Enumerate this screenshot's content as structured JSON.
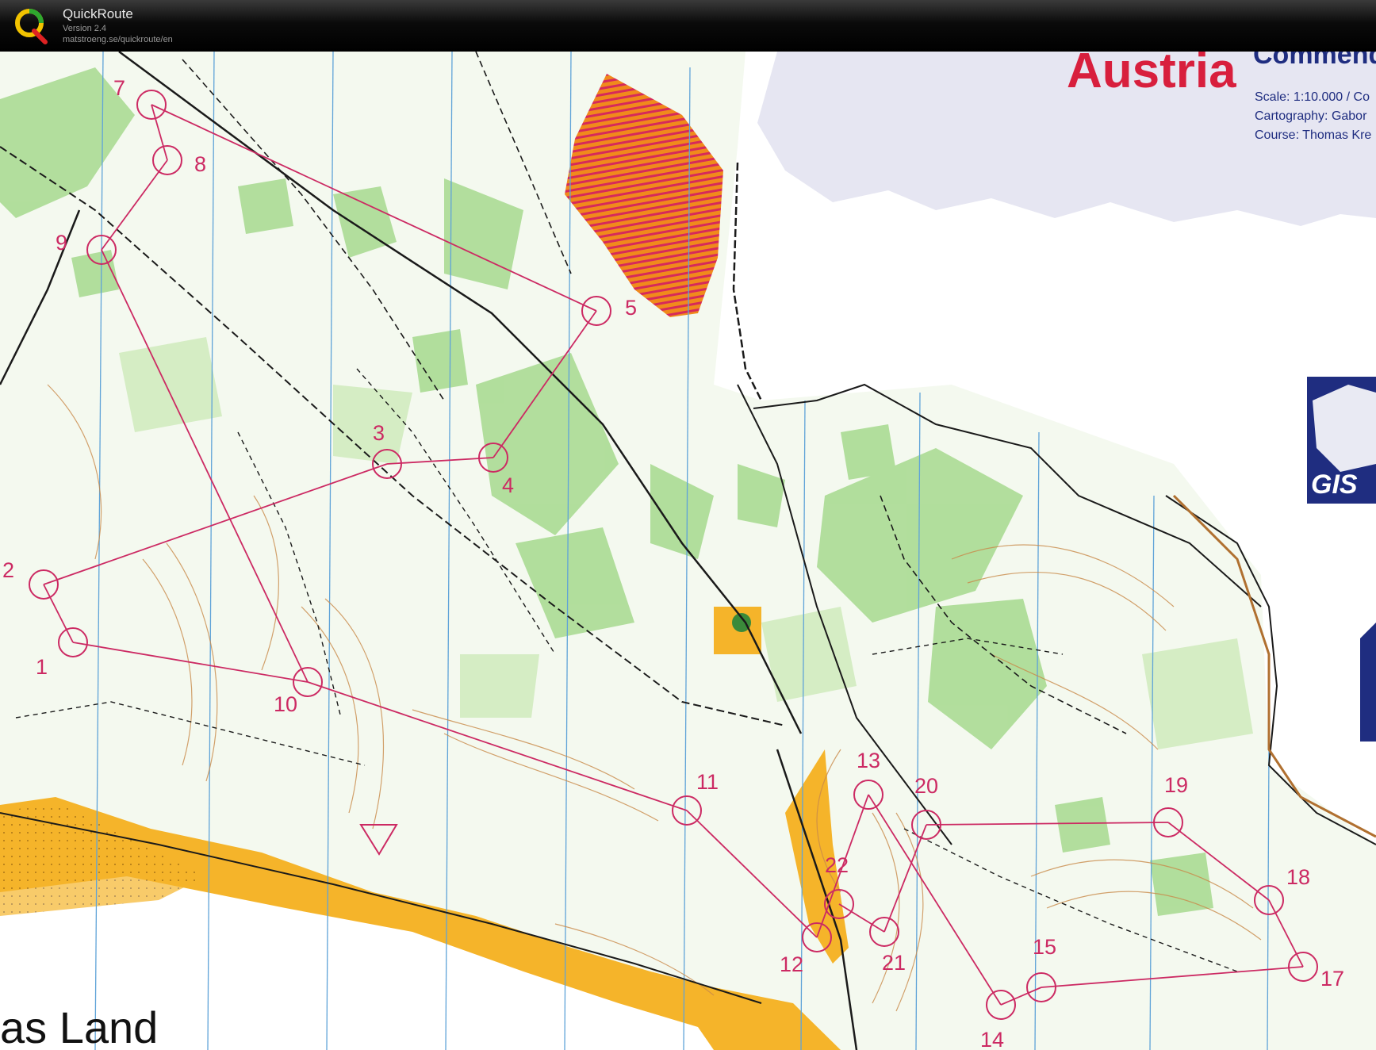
{
  "app": {
    "name": "QuickRoute",
    "version": "Version 2.4",
    "url": "matstroeng.se/quickroute/en"
  },
  "map_header": {
    "title_word": "Austria",
    "commendation": "Commende",
    "scale": "Scale: 1:10.000 / Co",
    "cartography": "Cartography: Gabor",
    "course": "Course: Thomas Kre",
    "gis_logo": "GIS"
  },
  "map_footer": {
    "text": "as Land"
  },
  "course": {
    "line_color": "#cc2a63",
    "controls": [
      {
        "label": "1"
      },
      {
        "label": "2"
      },
      {
        "label": "3"
      },
      {
        "label": "4"
      },
      {
        "label": "5"
      },
      {
        "label": "7"
      },
      {
        "label": "8"
      },
      {
        "label": "9"
      },
      {
        "label": "10"
      },
      {
        "label": "11"
      },
      {
        "label": "12"
      },
      {
        "label": "13"
      },
      {
        "label": "14"
      },
      {
        "label": "15"
      },
      {
        "label": "17"
      },
      {
        "label": "18"
      },
      {
        "label": "19"
      },
      {
        "label": "20"
      },
      {
        "label": "21"
      },
      {
        "label": "22"
      }
    ]
  }
}
